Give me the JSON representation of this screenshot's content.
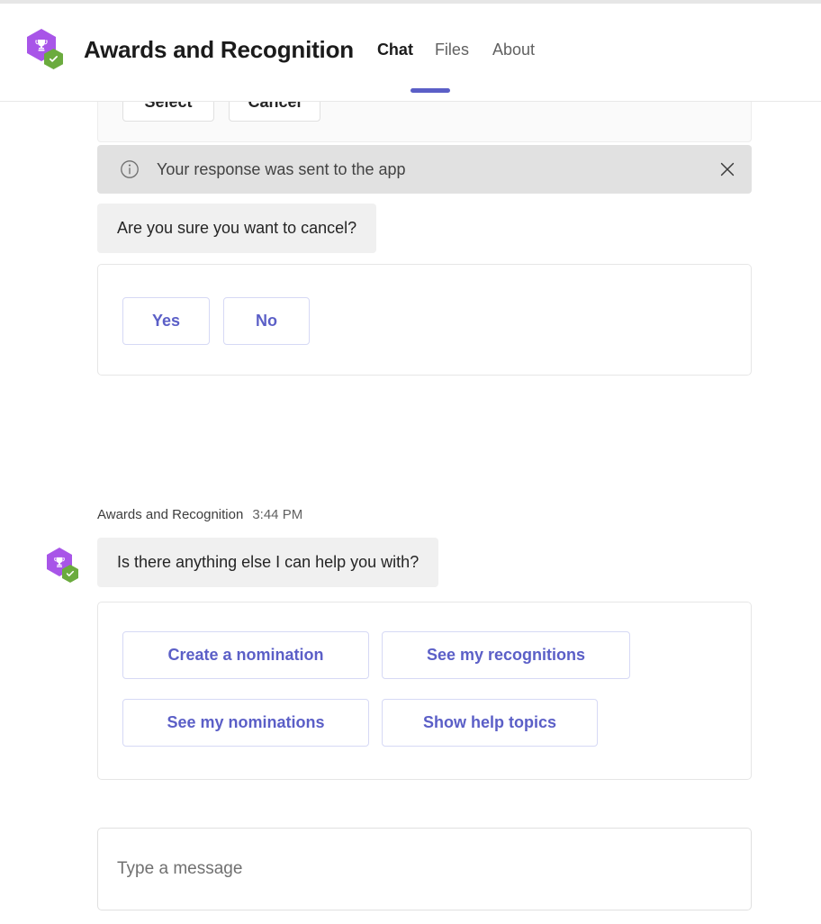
{
  "header": {
    "app_title": "Awards and Recognition",
    "avatar_icon": "trophy-hexagon-icon",
    "presence_icon": "available-check-badge-icon",
    "tabs": [
      {
        "label": "Chat",
        "active": true
      },
      {
        "label": "Files",
        "active": false
      },
      {
        "label": "About",
        "active": false
      }
    ],
    "accent_color": "#5b5fc7"
  },
  "chat": {
    "clipped_card": {
      "buttons": [
        {
          "label": "Select"
        },
        {
          "label": "Cancel"
        }
      ]
    },
    "notice": {
      "icon": "info-circle-icon",
      "text": "Your response was sent to the app",
      "close_icon": "close-icon",
      "background_color": "#e1e1e1"
    },
    "confirm_message": "Are you sure you want to cancel?",
    "confirm_card": {
      "buttons": [
        {
          "label": "Yes"
        },
        {
          "label": "No"
        }
      ]
    },
    "bot_message": {
      "sender": "Awards and Recognition",
      "timestamp": "3:44 PM",
      "text": "Is there anything else I can help you with?",
      "avatar_icon": "trophy-hexagon-icon",
      "presence_icon": "available-check-badge-icon"
    },
    "actions_card": {
      "buttons": [
        {
          "label": "Create a nomination"
        },
        {
          "label": "See my recognitions"
        },
        {
          "label": "See my nominations"
        },
        {
          "label": "Show help topics"
        }
      ],
      "button_color": "#5b5fc7"
    }
  },
  "composer": {
    "placeholder": "Type a message",
    "value": ""
  }
}
